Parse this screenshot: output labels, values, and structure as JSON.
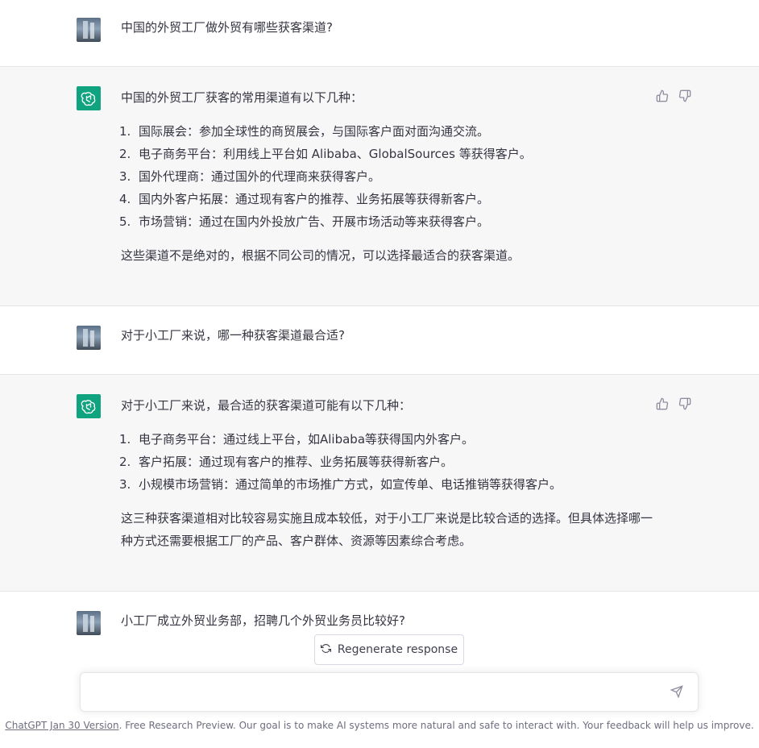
{
  "conversation": {
    "turns": [
      {
        "role": "user",
        "text": "中国的外贸工厂做外贸有哪些获客渠道?"
      },
      {
        "role": "assistant",
        "intro": "中国的外贸工厂获客的常用渠道有以下几种：",
        "items": [
          {
            "num": "1.",
            "text": "国际展会：参加全球性的商贸展会，与国际客户面对面沟通交流。"
          },
          {
            "num": "2.",
            "text": "电子商务平台：利用线上平台如 Alibaba、GlobalSources 等获得客户。"
          },
          {
            "num": "3.",
            "text": "国外代理商：通过国外的代理商来获得客户。"
          },
          {
            "num": "4.",
            "text": "国内外客户拓展：通过现有客户的推荐、业务拓展等获得新客户。"
          },
          {
            "num": "5.",
            "text": "市场营销：通过在国内外投放广告、开展市场活动等来获得客户。"
          }
        ],
        "outro": "这些渠道不是绝对的，根据不同公司的情况，可以选择最适合的获客渠道。"
      },
      {
        "role": "user",
        "text": "对于小工厂来说，哪一种获客渠道最合适?"
      },
      {
        "role": "assistant",
        "intro": "对于小工厂来说，最合适的获客渠道可能有以下几种：",
        "items": [
          {
            "num": "1.",
            "text": "电子商务平台：通过线上平台，如Alibaba等获得国内外客户。"
          },
          {
            "num": "2.",
            "text": "客户拓展：通过现有客户的推荐、业务拓展等获得新客户。"
          },
          {
            "num": "3.",
            "text": "小规模市场营销：通过简单的市场推广方式，如宣传单、电话推销等获得客户。"
          }
        ],
        "outro": "这三种获客渠道相对比较容易实施且成本较低，对于小工厂来说是比较合适的选择。但具体选择哪一种方式还需要根据工厂的产品、客户群体、资源等因素综合考虑。"
      },
      {
        "role": "user",
        "text": "小工厂成立外贸业务部，招聘几个外贸业务员比较好?"
      }
    ]
  },
  "controls": {
    "regenerate_label": "Regenerate response",
    "input_placeholder": "",
    "icons": {
      "thumbs_up": "thumbs-up-icon",
      "thumbs_down": "thumbs-down-icon",
      "send": "send-icon",
      "regenerate": "refresh-icon",
      "assistant_logo": "openai-logo-icon"
    }
  },
  "footer": {
    "version_link": "ChatGPT Jan 30 Version",
    "text": ". Free Research Preview. Our goal is to make AI systems more natural and safe to interact with. Your feedback will help us improve."
  },
  "colors": {
    "accent": "#10a37f",
    "assistant_bg": "#f7f7f8",
    "text": "#343541"
  }
}
